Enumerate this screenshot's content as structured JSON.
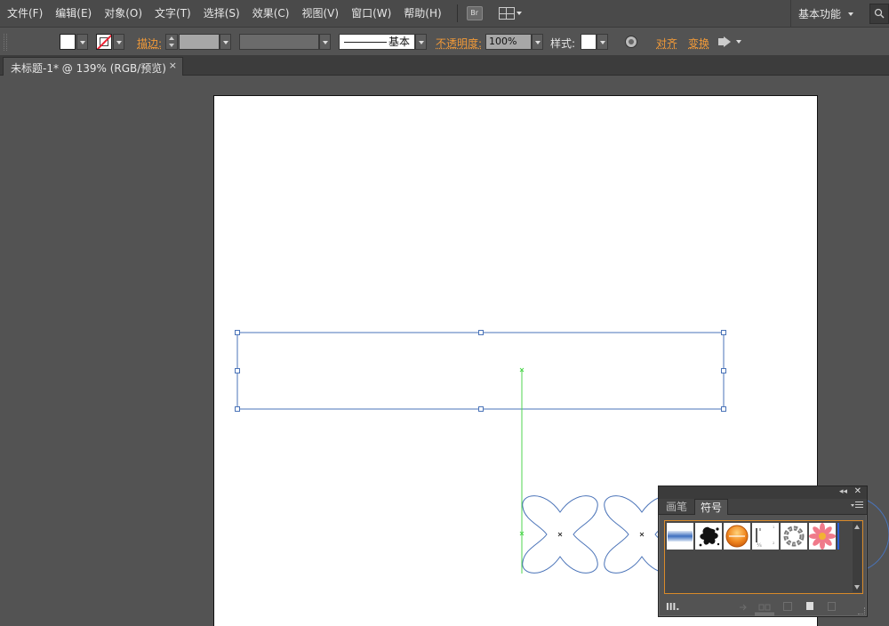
{
  "menubar": {
    "items": [
      "文件(F)",
      "编辑(E)",
      "对象(O)",
      "文字(T)",
      "选择(S)",
      "效果(C)",
      "视图(V)",
      "窗口(W)",
      "帮助(H)"
    ],
    "bridge_label": "Br",
    "workspace": "基本功能"
  },
  "controlbar": {
    "stroke_label": "描边:",
    "stroke_style": "基本",
    "opacity_label": "不透明度:",
    "opacity_value": "100%",
    "style_label": "样式:",
    "align_label": "对齐",
    "transform_label": "变换"
  },
  "document_tab": {
    "title": "未标题-1* @ 139% (RGB/预览)",
    "close": "×"
  },
  "symbols_panel": {
    "collapse": "◂◂",
    "close": "✕",
    "tabs": [
      "画笔",
      "符号"
    ],
    "active_tab": "符号",
    "symbols": [
      "blue-gradient-bar",
      "black-splat",
      "orange-button",
      "dotted-lines",
      "chain-ring",
      "pink-flower"
    ]
  },
  "colors": {
    "accent_orange": "#f29a38",
    "selection_blue": "#4a73b8",
    "guide_green": "#4fd64f"
  }
}
